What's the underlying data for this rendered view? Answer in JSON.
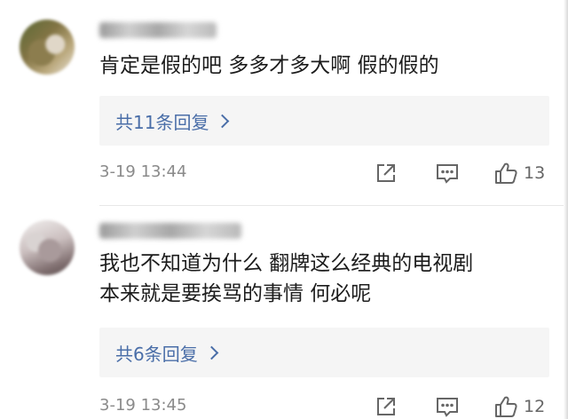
{
  "comments": [
    {
      "text_lines": [
        "肯定是假的吧 多多才多大啊 假的假的"
      ],
      "replies_label": "共11条回复",
      "timestamp": "3-19 13:44",
      "like_count": "13",
      "avatar": "blurred-avatar",
      "username": "blurred-username"
    },
    {
      "text_lines": [
        "我也不知道为什么 翻牌这么经典的电视剧",
        "本来就是要挨骂的事情 何必呢"
      ],
      "replies_label": "共6条回复",
      "timestamp": "3-19 13:45",
      "like_count": "12",
      "avatar": "blurred-avatar",
      "username": "blurred-username"
    }
  ],
  "icons": {
    "share": "share-icon",
    "reply": "comment-icon",
    "like": "thumbs-up-icon",
    "chevron": "chevron-right-icon"
  },
  "colors": {
    "link": "#4a6ea8",
    "reply_box_bg": "#f5f5f5",
    "timestamp": "#8a8a8a",
    "icon": "#666666"
  }
}
